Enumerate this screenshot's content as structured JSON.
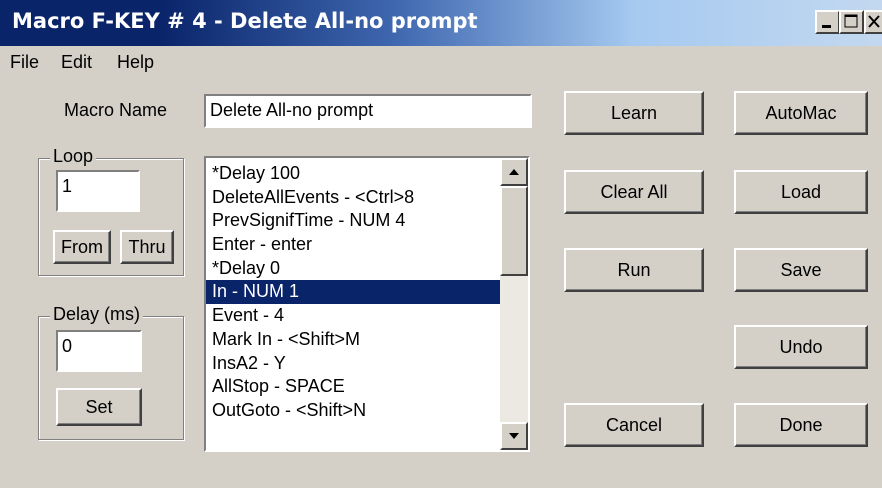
{
  "window": {
    "title": "Macro F-KEY # 4 - Delete All-no prompt",
    "controls": [
      "minimize-icon",
      "maximize-icon",
      "close-icon"
    ]
  },
  "menu": [
    "File",
    "Edit",
    "Help"
  ],
  "macro_name": {
    "label": "Macro Name",
    "value": "Delete All-no prompt"
  },
  "loop": {
    "title": "Loop",
    "value": "1",
    "from_label": "From",
    "thru_label": "Thru"
  },
  "delay": {
    "title": "Delay (ms)",
    "value": "0",
    "set_label": "Set"
  },
  "event_list": {
    "items": [
      "*Delay 100",
      "DeleteAllEvents - <Ctrl>8",
      "PrevSignifTime - NUM 4",
      "Enter - enter",
      "*Delay 0",
      "In - NUM 1",
      "Event - 4",
      "Mark In - <Shift>M",
      "InsA2 - Y",
      "AllStop - SPACE",
      "OutGoto - <Shift>N"
    ],
    "selected_index": 5
  },
  "buttons": {
    "learn": "Learn",
    "clear_all": "Clear All",
    "run": "Run",
    "cancel": "Cancel",
    "automac": "AutoMac",
    "load": "Load",
    "save": "Save",
    "undo": "Undo",
    "done": "Done"
  },
  "colors": {
    "title_active": "#0a246a",
    "title_fade": "#a6caf0",
    "selection": "#0a246a",
    "face": "#d4d0c8"
  }
}
